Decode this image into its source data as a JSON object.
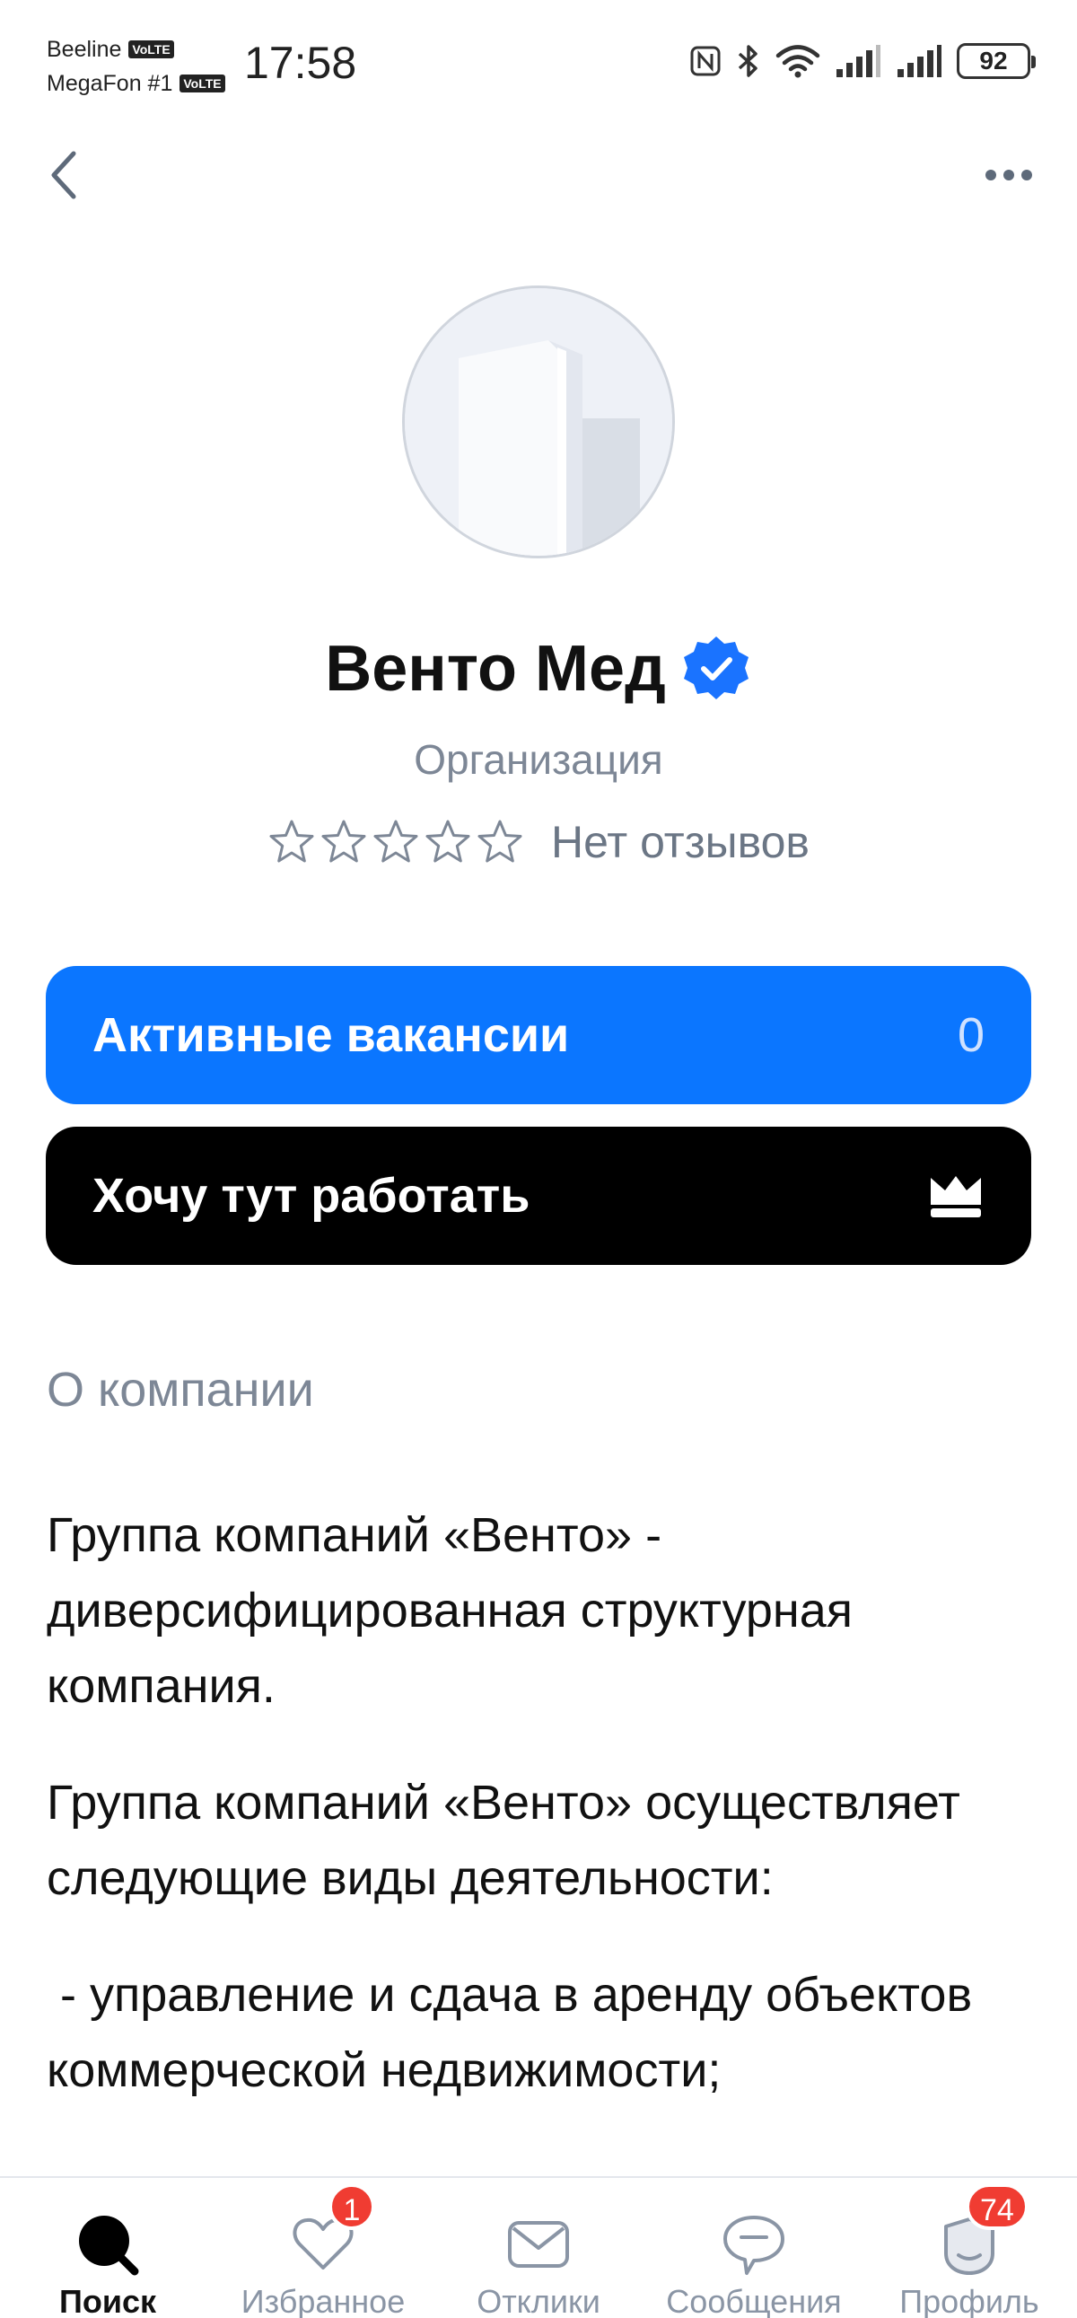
{
  "status_bar": {
    "carrier1": "Beeline",
    "carrier2": "MegaFon #1",
    "volte": "VoLTE",
    "time": "17:58",
    "battery": "92"
  },
  "header": {
    "back_icon": "chevron-left-icon",
    "more_icon": "more-dots-icon"
  },
  "company": {
    "name": "Венто Мед",
    "verified": true,
    "type": "Организация",
    "rating_stars": 0,
    "rating_max": 5,
    "reviews_text": "Нет отзывов"
  },
  "actions": {
    "vacancies_label": "Активные вакансии",
    "vacancies_count": "0",
    "want_work_label": "Хочу тут работать",
    "want_work_icon": "crown-icon"
  },
  "about": {
    "title": "О компании",
    "paragraphs": [
      "Группа компаний «Венто» - диверсифицированная структурная компания.",
      "Группа компаний «Венто» осуществляет следующие виды деятельности:",
      " - управление и сдача в аренду объектов коммерческой недвижимости;"
    ]
  },
  "bottom_nav": {
    "items": [
      {
        "label": "Поиск",
        "icon": "search-icon",
        "active": true
      },
      {
        "label": "Избранное",
        "icon": "heart-icon",
        "badge": "1"
      },
      {
        "label": "Отклики",
        "icon": "envelope-icon"
      },
      {
        "label": "Сообщения",
        "icon": "chat-icon"
      },
      {
        "label": "Профиль",
        "icon": "profile-icon",
        "badge": "74"
      }
    ]
  },
  "colors": {
    "primary_blue": "#0b76ff",
    "black_button": "#000000",
    "muted_text": "#7d8796",
    "badge_red": "#f03c32"
  }
}
